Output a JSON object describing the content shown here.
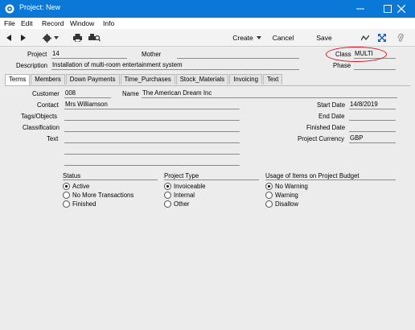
{
  "window": {
    "title": "Project: New"
  },
  "menu": {
    "items": [
      "File",
      "Edit",
      "Record",
      "Window",
      "Info"
    ]
  },
  "toolbar": {
    "create_label": "Create",
    "cancel_label": "Cancel",
    "save_label": "Save"
  },
  "header": {
    "project_label": "Project",
    "project_value": "14",
    "mother_label": "Mother",
    "mother_value": "",
    "class_label": "Class",
    "class_value": "MULTI",
    "description_label": "Description",
    "description_value": "Installation of multi-room entertainment system",
    "phase_label": "Phase",
    "phase_value": ""
  },
  "tabs": [
    "Terms",
    "Members",
    "Down Payments",
    "Time_Purchases",
    "Stock_Materials",
    "Invoicing",
    "Text"
  ],
  "terms": {
    "customer_label": "Customer",
    "customer_value": "008",
    "name_label": "Name",
    "name_value": "The American Dream Inc",
    "contact_label": "Contact",
    "contact_value": "Mrs Williamson",
    "tags_label": "Tags/Objects",
    "tags_value": "",
    "classification_label": "Classification",
    "classification_value": "",
    "text_label": "Text",
    "text_value": "",
    "start_date_label": "Start Date",
    "start_date_value": "14/8/2019",
    "end_date_label": "End Date",
    "end_date_value": "",
    "finished_date_label": "Finished Date",
    "finished_date_value": "",
    "currency_label": "Project Currency",
    "currency_value": "GBP"
  },
  "status": {
    "title": "Status",
    "options": [
      "Active",
      "No More Transactions",
      "Finished"
    ],
    "selected": "Active"
  },
  "project_type": {
    "title": "Project Type",
    "options": [
      "Invoiceable",
      "Internal",
      "Other"
    ],
    "selected": "Invoiceable"
  },
  "usage": {
    "title": "Usage of Items on Project Budget",
    "options": [
      "No Warning",
      "Warning",
      "Disallow"
    ],
    "selected": "No Warning"
  },
  "colors": {
    "titlebar": "#0a78d7",
    "annotation": "#d4141e"
  }
}
